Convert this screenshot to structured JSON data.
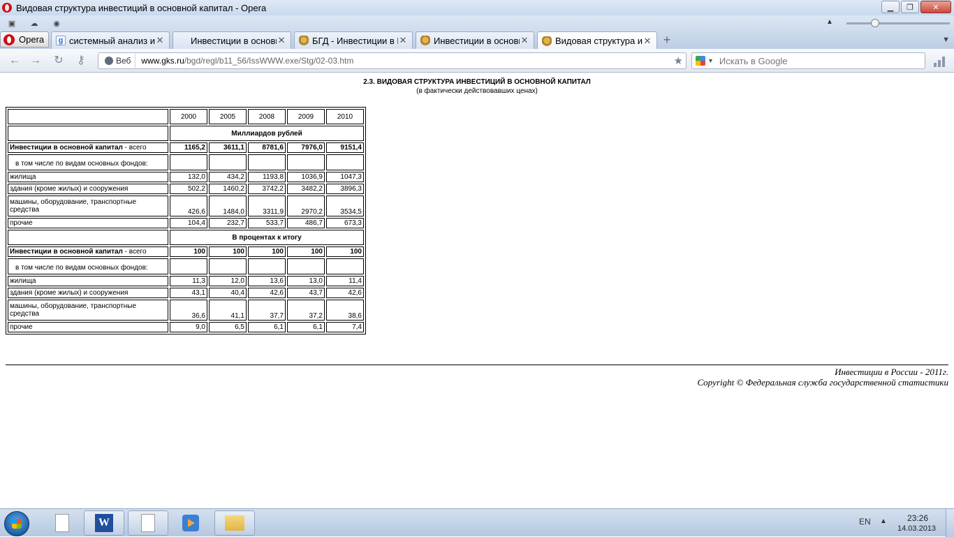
{
  "window": {
    "title": "Видовая структура инвестиций в основной капитал - Opera"
  },
  "tabbar": {
    "menu_label": "Opera",
    "tabs": [
      {
        "label": "системный анализ ин..."
      },
      {
        "label": "Инвестиции в основн..."
      },
      {
        "label": "БГД - Инвестиции в Р..."
      },
      {
        "label": "Инвестиции в основн..."
      },
      {
        "label": "Видовая структура ин..."
      }
    ],
    "close_glyph": "✕"
  },
  "addressbar": {
    "badge": "Веб",
    "url_host": "www.gks.ru",
    "url_path": "/bgd/regl/b11_56/IssWWW.exe/Stg/02-03.htm",
    "search_placeholder": "Искать в Google"
  },
  "page": {
    "title": "2.3. ВИДОВАЯ СТРУКТУРА ИНВЕСТИЦИЙ В ОСНОВНОЙ КАПИТАЛ",
    "subtitle": "(в фактически действовавших ценах)",
    "years": [
      "2000",
      "2005",
      "2008",
      "2009",
      "2010"
    ],
    "section1": "Миллиардов рублей",
    "section2": "В процентах к итогу",
    "total_label_bold": "Инвестиции в основной капитал",
    "total_label_rest": " - всего",
    "subheading": "в том числе по видам основных фондов:",
    "row_labels": {
      "housing": "жилища",
      "buildings": "здания (кроме жилых) и сооружения",
      "machinery": "машины, оборудование, транспортные средства",
      "other": "прочие"
    },
    "rub": {
      "total": [
        "1165,2",
        "3611,1",
        "8781,6",
        "7976,0",
        "9151,4"
      ],
      "housing": [
        "132,0",
        "434,2",
        "1193,8",
        "1036,9",
        "1047,3"
      ],
      "buildings": [
        "502,2",
        "1460,2",
        "3742,2",
        "3482,2",
        "3896,3"
      ],
      "machinery": [
        "426,6",
        "1484,0",
        "3311,9",
        "2970,2",
        "3534,5"
      ],
      "other": [
        "104,4",
        "232,7",
        "533,7",
        "486,7",
        "673,3"
      ]
    },
    "pct": {
      "total": [
        "100",
        "100",
        "100",
        "100",
        "100"
      ],
      "housing": [
        "11,3",
        "12,0",
        "13,6",
        "13,0",
        "11,4"
      ],
      "buildings": [
        "43,1",
        "40,4",
        "42,6",
        "43,7",
        "42,6"
      ],
      "machinery": [
        "36,6",
        "41,1",
        "37,7",
        "37,2",
        "38,6"
      ],
      "other": [
        "9,0",
        "6,5",
        "6,1",
        "6,1",
        "7,4"
      ]
    },
    "footer1": "Инвестиции в России - 2011г.",
    "footer2": "Copyright © Федеральная служба государственной статистики"
  },
  "taskbar": {
    "lang": "EN",
    "time": "23:26",
    "date": "14.03.2013"
  }
}
